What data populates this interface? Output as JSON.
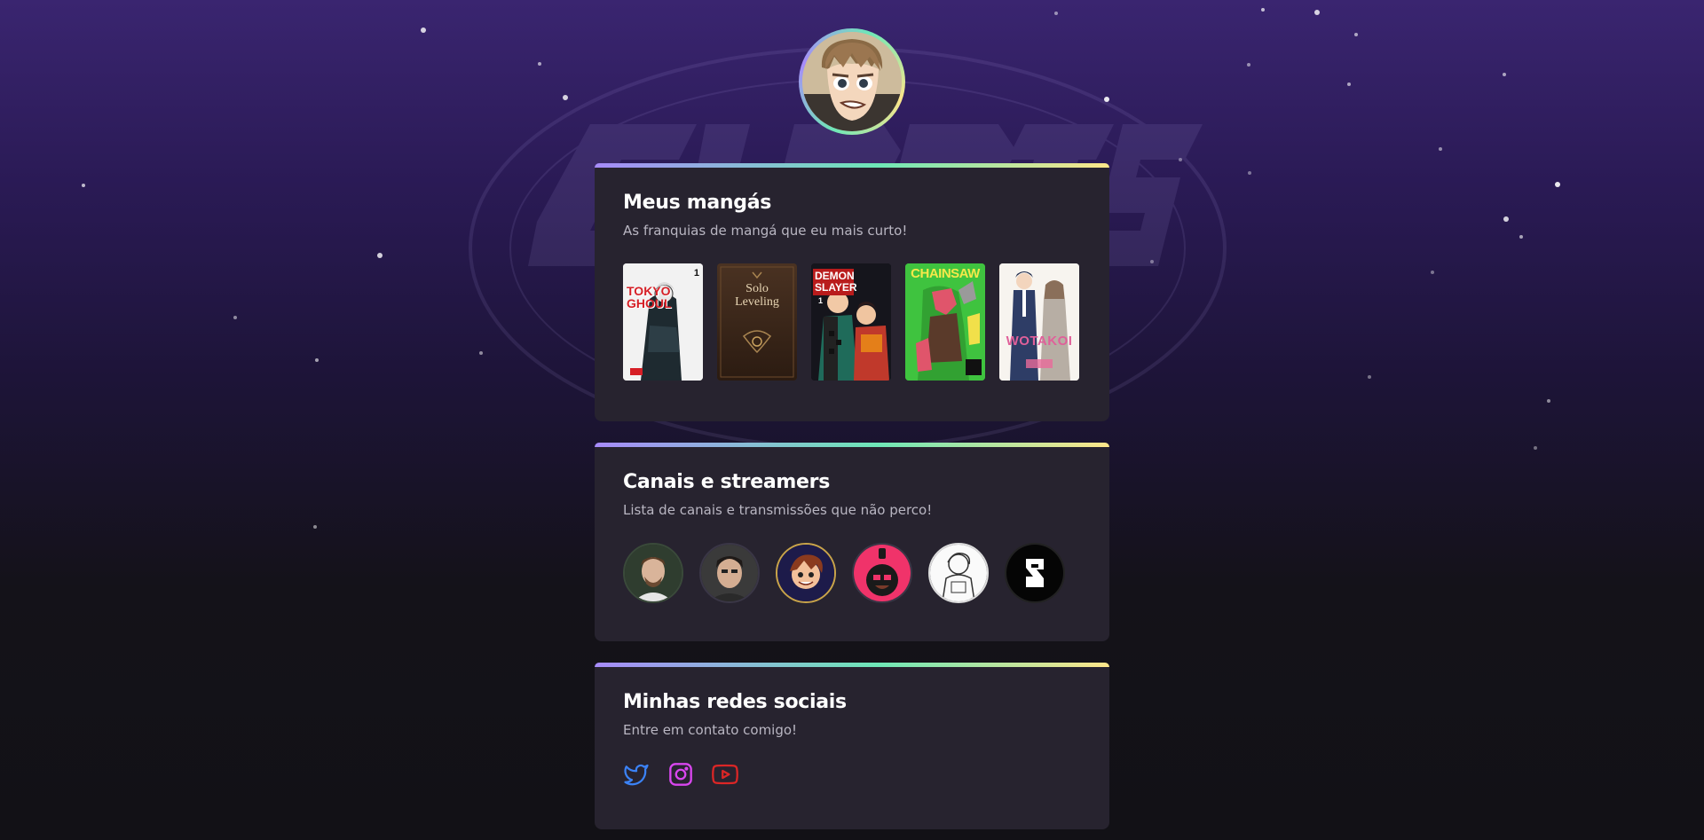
{
  "colors": {
    "background_top": "#3a2570",
    "background_bottom": "#121116",
    "card": "#27232f",
    "accent_gradient": [
      "#a78bfa",
      "#6ee7b7",
      "#fde68a"
    ],
    "twitter": "#3b82f6",
    "instagram": "#d946ef",
    "youtube": "#dc2626"
  },
  "profile": {
    "avatar_icon": "anime-avatar"
  },
  "mangas": {
    "title": "Meus mangás",
    "subtitle": "As franquias de mangá que eu mais curto!",
    "items": [
      {
        "title": "TOKYO GHOUL",
        "volume": "1"
      },
      {
        "title": "Solo Leveling"
      },
      {
        "title": "DEMON SLAYER",
        "volume": "1"
      },
      {
        "title": "CHAINSAW"
      },
      {
        "title": "WOTAKOI"
      }
    ]
  },
  "streamers": {
    "title": "Canais e streamers",
    "subtitle": "Lista de canais e transmissões que não perco!",
    "items": [
      {
        "icon": "streamer-avatar-1"
      },
      {
        "icon": "streamer-avatar-2"
      },
      {
        "icon": "streamer-avatar-3"
      },
      {
        "icon": "streamer-avatar-4"
      },
      {
        "icon": "streamer-avatar-5"
      },
      {
        "icon": "streamer-avatar-6"
      }
    ]
  },
  "social": {
    "title": "Minhas redes sociais",
    "subtitle": "Entre em contato comigo!",
    "items": [
      {
        "icon": "twitter-icon"
      },
      {
        "icon": "instagram-icon"
      },
      {
        "icon": "youtube-icon"
      }
    ]
  }
}
